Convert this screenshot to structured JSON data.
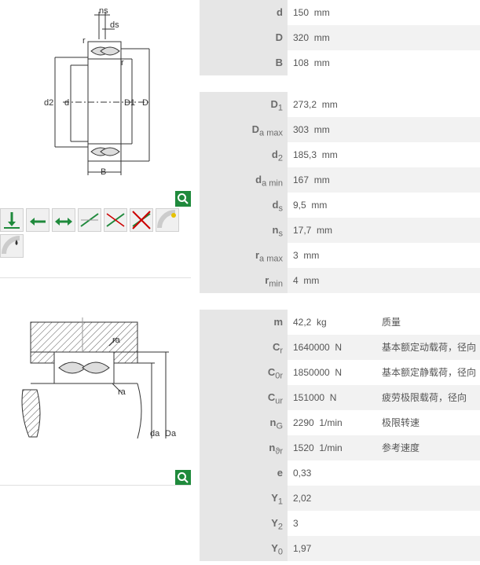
{
  "drawing1": {
    "labels": {
      "ns": "ns",
      "ds": "ds",
      "r_top": "r",
      "r_right": "r",
      "d2": "d2",
      "d": "d",
      "D1": "D1",
      "D": "D",
      "B": "B"
    }
  },
  "drawing2": {
    "labels": {
      "ra_top": "ra",
      "ra_bottom": "ra",
      "da": "da",
      "Da": "Da"
    }
  },
  "icon_names": [
    "radial-load-icon",
    "axial-load-one-direction-icon",
    "axial-load-both-directions-icon",
    "misalignment-icon",
    "misalignment-compensation-icon",
    "no-tilt-icon",
    "sealed-icon",
    "oil-lubrication-icon"
  ],
  "groups": [
    [
      {
        "sym": "d",
        "sub": "",
        "val": "150",
        "unit": "mm"
      },
      {
        "sym": "D",
        "sub": "",
        "val": "320",
        "unit": "mm"
      },
      {
        "sym": "B",
        "sub": "",
        "val": "108",
        "unit": "mm"
      }
    ],
    [
      {
        "sym": "D",
        "sub": "1",
        "val": "273,2",
        "unit": "mm"
      },
      {
        "sym": "D",
        "sub": "a max",
        "val": "303",
        "unit": "mm"
      },
      {
        "sym": "d",
        "sub": "2",
        "val": "185,3",
        "unit": "mm"
      },
      {
        "sym": "d",
        "sub": "a min",
        "val": "167",
        "unit": "mm"
      },
      {
        "sym": "d",
        "sub": "s",
        "val": "9,5",
        "unit": "mm"
      },
      {
        "sym": "n",
        "sub": "s",
        "val": "17,7",
        "unit": "mm"
      },
      {
        "sym": "r",
        "sub": "a max",
        "val": "3",
        "unit": "mm"
      },
      {
        "sym": "r",
        "sub": "min",
        "val": "4",
        "unit": "mm"
      }
    ],
    [
      {
        "sym": "m",
        "sub": "",
        "val": "42,2",
        "unit": "kg",
        "desc": "质量"
      },
      {
        "sym": "C",
        "sub": "r",
        "val": "1640000",
        "unit": "N",
        "desc": "基本额定动载荷，径向"
      },
      {
        "sym": "C",
        "sub": "0r",
        "val": "1850000",
        "unit": "N",
        "desc": "基本额定静载荷，径向"
      },
      {
        "sym": "C",
        "sub": "ur",
        "val": "151000",
        "unit": "N",
        "desc": "疲劳极限载荷，径向"
      },
      {
        "sym": "n",
        "sub": "G",
        "val": "2290",
        "unit": "1/min",
        "desc": "极限转速"
      },
      {
        "sym": "n",
        "sub": "ϑr",
        "val": "1520",
        "unit": "1/min",
        "desc": "参考速度"
      },
      {
        "sym": "e",
        "sub": "",
        "val": "0,33",
        "unit": ""
      },
      {
        "sym": "Y",
        "sub": "1",
        "val": "2,02",
        "unit": ""
      },
      {
        "sym": "Y",
        "sub": "2",
        "val": "3",
        "unit": ""
      },
      {
        "sym": "Y",
        "sub": "0",
        "val": "1,97",
        "unit": ""
      }
    ]
  ]
}
